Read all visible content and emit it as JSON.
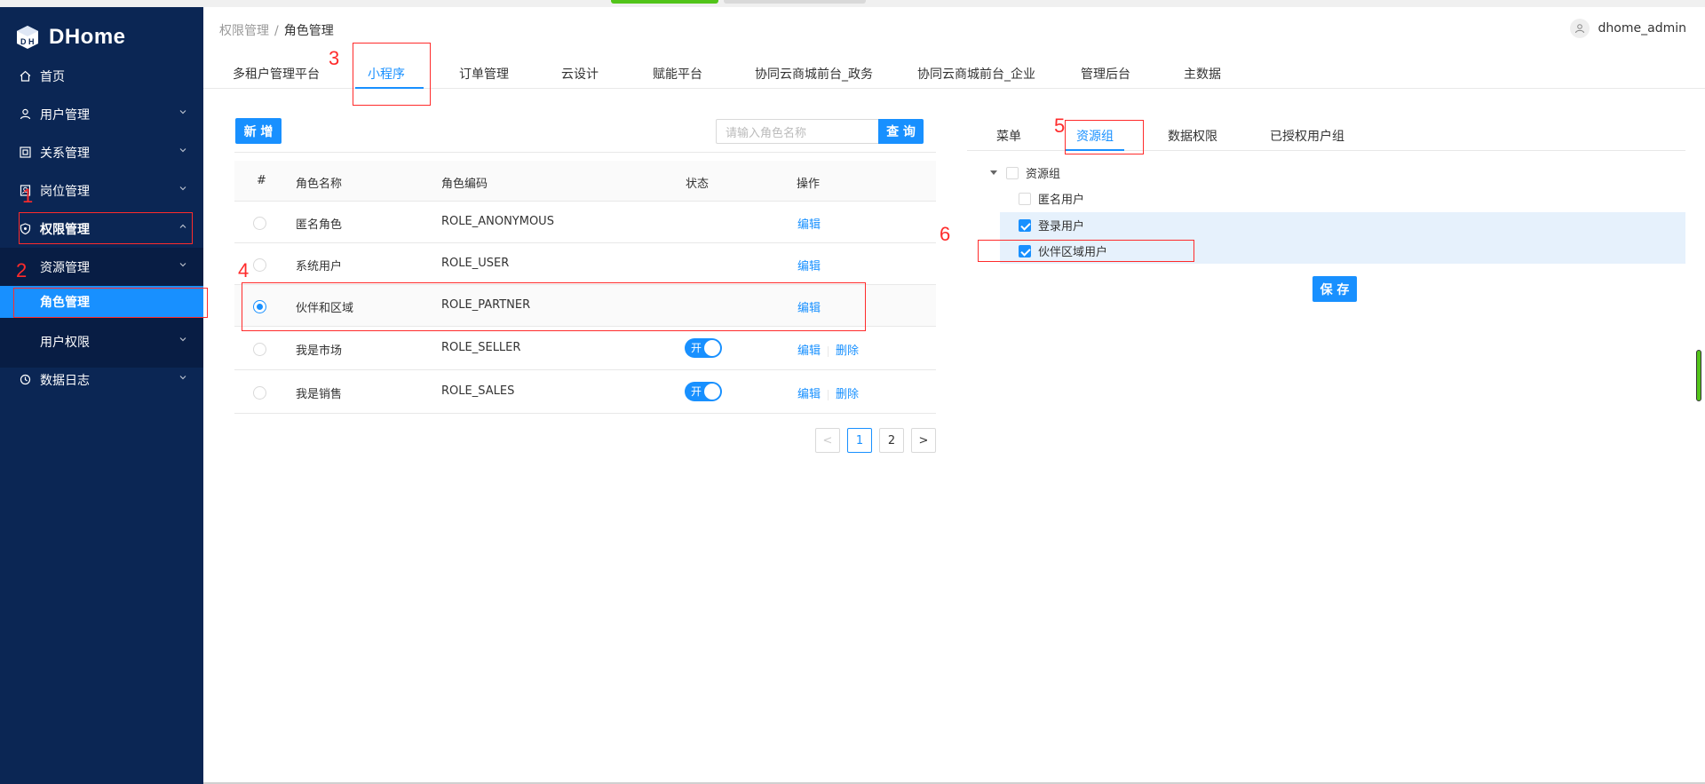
{
  "app": {
    "name": "DHome"
  },
  "sidebar": {
    "items": [
      {
        "label": "首页",
        "icon": "home-icon"
      },
      {
        "label": "用户管理",
        "icon": "user-icon"
      },
      {
        "label": "关系管理",
        "icon": "relation-icon"
      },
      {
        "label": "岗位管理",
        "icon": "post-icon"
      },
      {
        "label": "权限管理",
        "icon": "shield-icon"
      },
      {
        "label": "资源管理"
      },
      {
        "label": "角色管理"
      },
      {
        "label": "用户权限"
      },
      {
        "label": "数据日志",
        "icon": "log-icon"
      }
    ]
  },
  "header": {
    "breadcrumb": [
      "权限管理",
      "角色管理"
    ],
    "username": "dhome_admin"
  },
  "top_tabs": [
    "多租户管理平台",
    "小程序",
    "订单管理",
    "云设计",
    "赋能平台",
    "协同云商城前台_政务",
    "协同云商城前台_企业",
    "管理后台",
    "主数据"
  ],
  "toolbar": {
    "add_label": "新 增",
    "search_placeholder": "请输入角色名称",
    "query_label": "查 询"
  },
  "table": {
    "columns": [
      "#",
      "角色名称",
      "角色编码",
      "状态",
      "操作"
    ],
    "rows": [
      {
        "name": "匿名角色",
        "code": "ROLE_ANONYMOUS",
        "edit": "编辑"
      },
      {
        "name": "系统用户",
        "code": "ROLE_USER",
        "edit": "编辑"
      },
      {
        "name": "伙伴和区域",
        "code": "ROLE_PARTNER",
        "edit": "编辑",
        "selected": true
      },
      {
        "name": "我是市场",
        "code": "ROLE_SELLER",
        "status": "开",
        "edit": "编辑",
        "delete": "删除"
      },
      {
        "name": "我是销售",
        "code": "ROLE_SALES",
        "status": "开",
        "edit": "编辑",
        "delete": "删除"
      }
    ]
  },
  "pager": {
    "pages": [
      "1",
      "2"
    ],
    "current": "1",
    "prev": "<",
    "next": ">"
  },
  "right_tabs": [
    "菜单",
    "资源组",
    "数据权限",
    "已授权用户组"
  ],
  "tree": {
    "root": "资源组",
    "children": [
      {
        "label": "匿名用户",
        "checked": false
      },
      {
        "label": "登录用户",
        "checked": true
      },
      {
        "label": "伙伴区域用户",
        "checked": true
      }
    ]
  },
  "save_label": "保 存",
  "annotations": [
    "1",
    "2",
    "3",
    "4",
    "5",
    "6"
  ],
  "colors": {
    "sidebar": "#0b2654",
    "primary": "#1890ff",
    "annotation": "#ff2b2b"
  }
}
